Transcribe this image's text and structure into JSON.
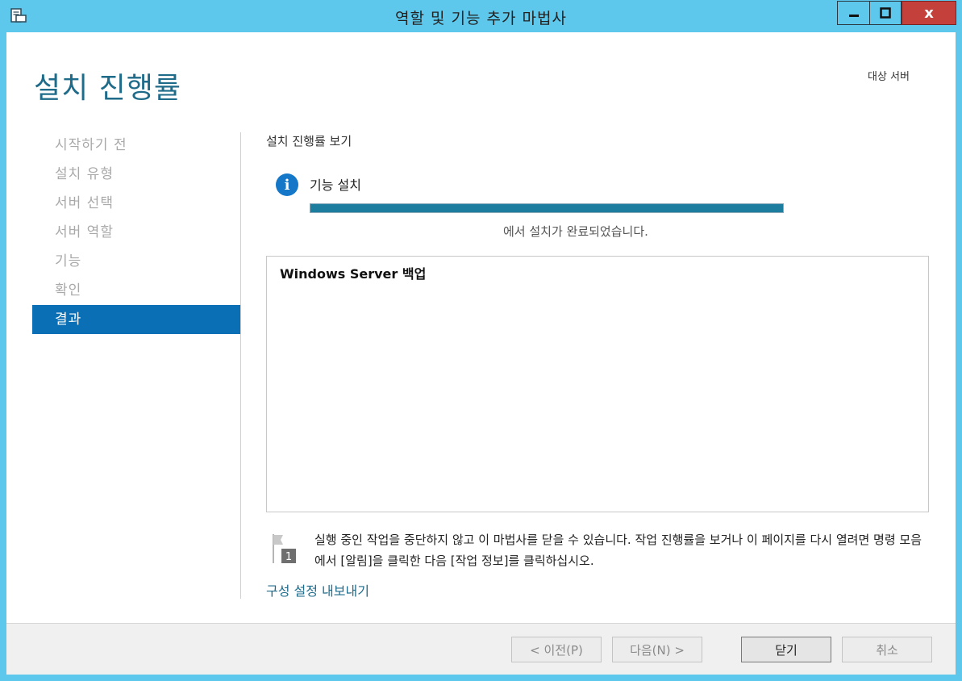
{
  "window": {
    "title": "역할 및 기능 추가 마법사",
    "close_glyph": "x"
  },
  "header": {
    "page_title": "설치 진행률",
    "target_server_label": "대상 서버"
  },
  "nav": {
    "items": [
      {
        "label": "시작하기 전"
      },
      {
        "label": "설치 유형"
      },
      {
        "label": "서버 선택"
      },
      {
        "label": "서버 역할"
      },
      {
        "label": "기능"
      },
      {
        "label": "확인"
      },
      {
        "label": "결과"
      }
    ],
    "active_index": 6
  },
  "main": {
    "section_heading": "설치 진행률 보기",
    "status_title": "기능 설치",
    "progress_percent": 100,
    "result_text": "에서 설치가 완료되었습니다.",
    "installed_features": [
      "Windows Server 백업"
    ],
    "note_text": "실행 중인 작업을 중단하지 않고 이 마법사를 닫을 수 있습니다. 작업 진행률을 보거나 이 페이지를 다시 열려면 명령 모음에서 [알림]을 클릭한 다음 [작업 정보]를 클릭하십시오.",
    "note_icon_badge": "1",
    "export_link": "구성 설정 내보내기"
  },
  "footer": {
    "prev_label": "< 이전(P)",
    "next_label": "다음(N) >",
    "close_label": "닫기",
    "cancel_label": "취소"
  },
  "colors": {
    "title_bar": "#5ec8ec",
    "active_nav": "#0a6fb5",
    "progress_fill": "#1c7d9e",
    "link": "#1f6b8a"
  },
  "icons": {
    "app": "wizard-app-icon",
    "info": "info-icon",
    "note": "flag-notification-icon"
  }
}
